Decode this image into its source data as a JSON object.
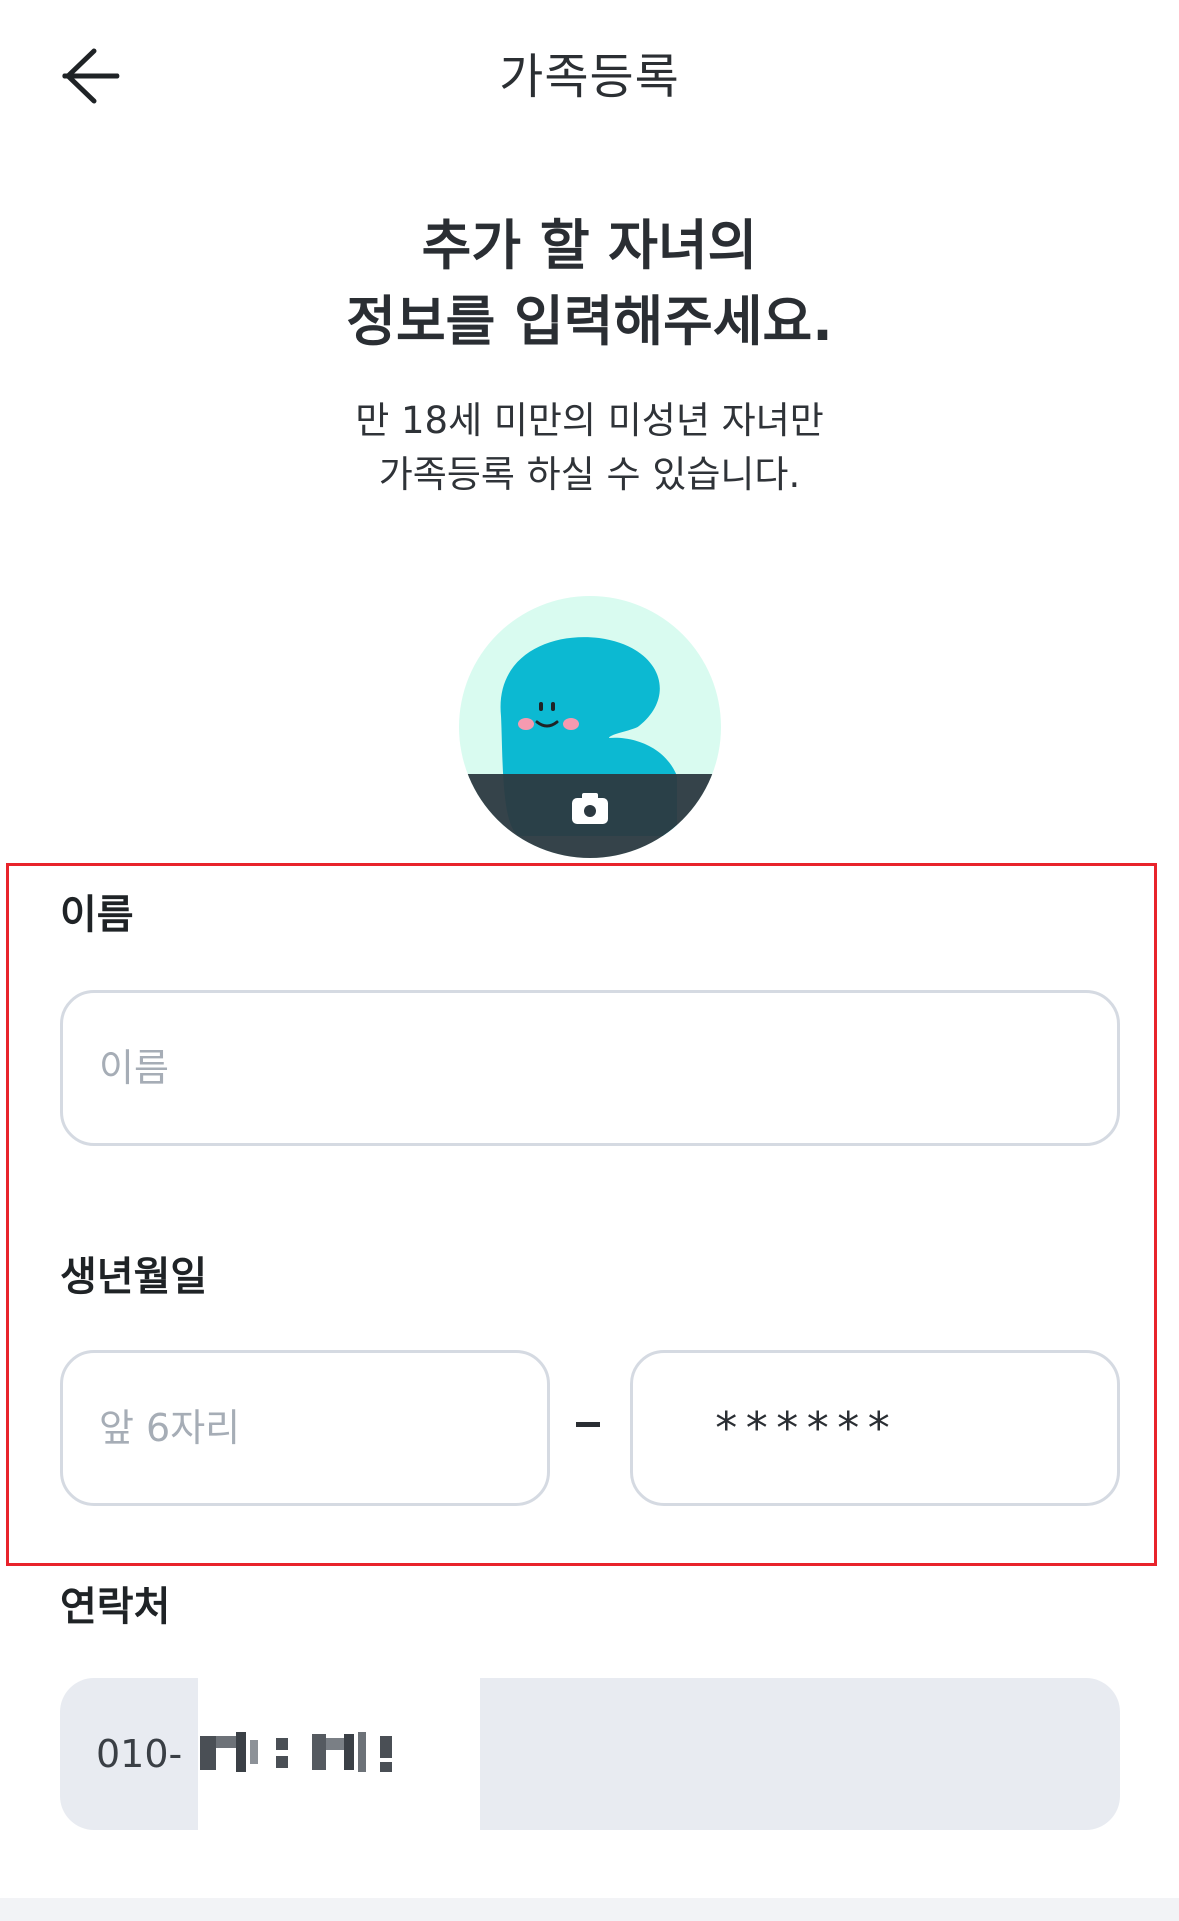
{
  "header": {
    "title": "가족등록"
  },
  "intro": {
    "headline_line1": "추가 할 자녀의",
    "headline_line2": "정보를 입력해주세요.",
    "sub_line1": "만 18세 미만의 미성년 자녀만",
    "sub_line2": "가족등록 하실 수 있습니다."
  },
  "avatar": {
    "camera_icon": "camera-icon",
    "mascot": "blue-blob-character"
  },
  "form": {
    "name": {
      "label": "이름",
      "placeholder": "이름",
      "value": ""
    },
    "birth": {
      "label": "생년월일",
      "front_placeholder": "앞 6자리",
      "front_value": "",
      "separator": "–",
      "back_masked": "******"
    },
    "contact": {
      "label": "연락처",
      "prefix": "010-"
    }
  },
  "colors": {
    "highlight_border": "#e8232b",
    "input_border": "#d5dae2",
    "disabled_bg": "#e8ebf1",
    "avatar_bg": "#d9fbf0",
    "mascot": "#0cb9d2",
    "overlay": "#2c3940"
  }
}
